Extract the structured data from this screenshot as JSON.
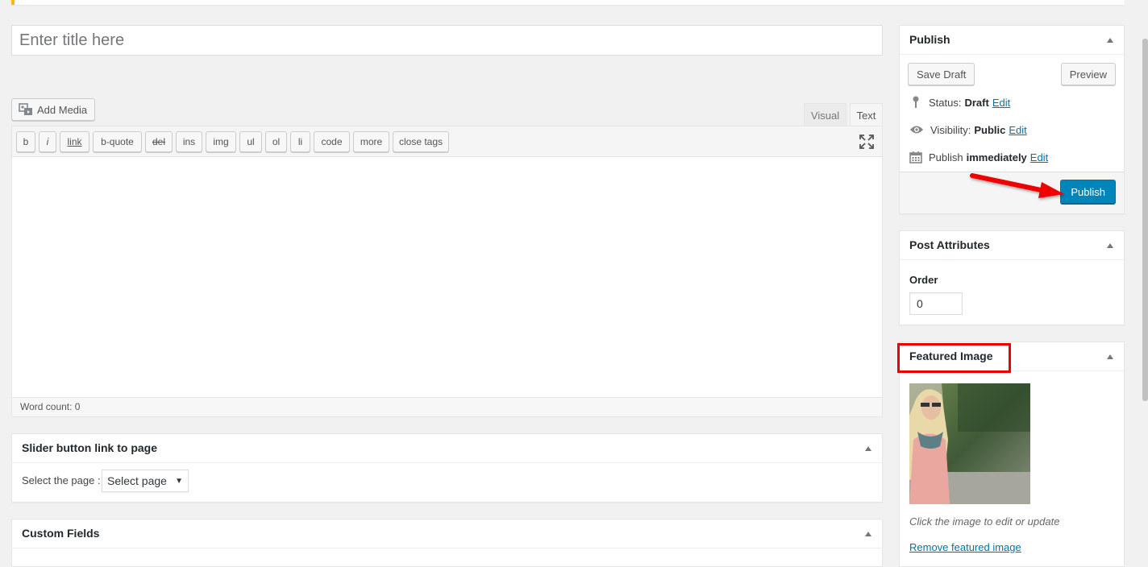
{
  "editor": {
    "title_placeholder": "Enter title here",
    "add_media_label": "Add Media",
    "tabs": [
      {
        "label": "Visual",
        "active": false
      },
      {
        "label": "Text",
        "active": true
      }
    ],
    "quicktags": [
      "b",
      "i",
      "link",
      "b-quote",
      "del",
      "ins",
      "img",
      "ul",
      "ol",
      "li",
      "code",
      "more",
      "close tags"
    ],
    "word_count": "Word count: 0"
  },
  "publish_box": {
    "title": "Publish",
    "save_draft_label": "Save Draft",
    "preview_label": "Preview",
    "status_label": "Status:",
    "status_value": "Draft",
    "visibility_label": "Visibility:",
    "visibility_value": "Public",
    "publish_label": "Publish",
    "publish_value": "immediately",
    "edit_label": "Edit",
    "publish_button_label": "Publish"
  },
  "post_attributes": {
    "title": "Post Attributes",
    "order_label": "Order",
    "order_value": "0"
  },
  "featured_image": {
    "title": "Featured Image",
    "hint": "Click the image to edit or update",
    "remove_label": "Remove featured image"
  },
  "slider_box": {
    "title": "Slider button link to page",
    "select_label": "Select the page :",
    "select_value": "Select page"
  },
  "custom_fields": {
    "title": "Custom Fields"
  },
  "colors": {
    "primary_button": "#0085ba",
    "link": "#0073aa",
    "annotation": "#e00000",
    "notice": "#ffb900"
  }
}
